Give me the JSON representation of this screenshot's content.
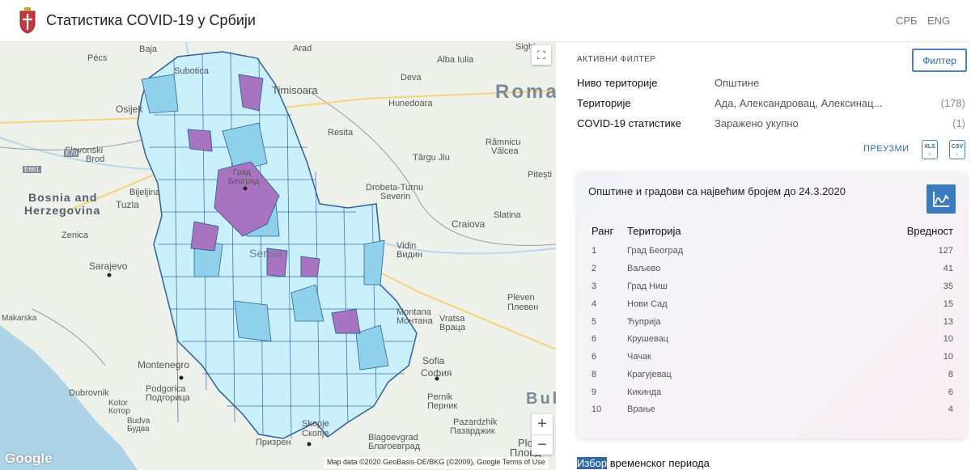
{
  "header": {
    "title": "Статистика COVID-19 у Србији",
    "lang_srb": "СРБ",
    "lang_eng": "ENG"
  },
  "map": {
    "labels": {
      "pecs": "Pécs",
      "baja": "Baja",
      "arad": "Arad",
      "sighisoara": "Sighi",
      "alba_iulia": "Alba Iulia",
      "subotica": "Subotica",
      "timisoara": "Timisoara",
      "deva": "Deva",
      "hunedoara": "Hunedoara",
      "roma": "Roma",
      "osijek": "Osijek",
      "resita": "Resita",
      "ramnicu": "Râmnicu",
      "valcea": "Vâlcea",
      "slavonski": "Slavonski",
      "brod": "Brod",
      "targu_jiu": "Târgu Jiu",
      "pitesti": "Pitești",
      "bosnia": "Bosnia and",
      "herzegovina": "Herzegovina",
      "bijeljina": "Bijeljina",
      "tuzla": "Tuzla",
      "drobeta": "Drobeta-Turnu",
      "severin": "Severin",
      "craiova": "Craiova",
      "slatina": "Slatina",
      "zenica": "Zenica",
      "vidin": "Vidin",
      "vidin_cyr": "Видин",
      "sarajevo": "Sarajevo",
      "serbia": "Serbia",
      "makarska": "Makarska",
      "pleven": "Pleven",
      "pleven_cyr": "Плевен",
      "montana": "Montana",
      "montana_cyr": "Монтана",
      "vratsa": "Vratsa",
      "vratsa_cyr": "Враца",
      "montenegro": "Montenegro",
      "sofia": "Sofia",
      "sofia_cyr": "София",
      "dubrovnik": "Dubrovnik",
      "podgorica": "Podgorica",
      "podgorica_cyr": "Подгорица",
      "bul": "Bul",
      "pernik": "Pernik",
      "pernik_cyr": "Перник",
      "kotor": "Kotor",
      "kotor_cyr": "Котор",
      "budva": "Budva",
      "budva_cyr": "Будва",
      "pazardzhik": "Pazardzhik",
      "pazardzhik_cyr": "Пазарджик",
      "skopje": "Skopje",
      "skopje_cyr": "Скопје",
      "prizren": "Призрен",
      "blagoevgrad": "Blagoevgrad",
      "blagoevgrad_cyr": "Благоевград",
      "plov": "Plov",
      "plov_cyr": "Пловд",
      "grad": "Град",
      "beograd": "Београд"
    },
    "roads": {
      "e70": "E70",
      "e661": "E661"
    },
    "google": "Google",
    "attribution": "Map data ©2020 GeoBasis-DE/BKG (©2009), Google   Terms of Use",
    "fullscreen_icon": "⛶",
    "zoom_in": "+",
    "zoom_out": "−",
    "colors": {
      "light": "#c9f0fb",
      "medium": "#8fd0ea",
      "high": "#a874c0",
      "border": "#2f5f9e"
    }
  },
  "filter": {
    "title": "АКТИВНИ ФИЛТЕР",
    "button": "Филтер",
    "rows": [
      {
        "key": "Ниво територије",
        "value": "Општине",
        "count": ""
      },
      {
        "key": "Територије",
        "value": "Ада, Александровац, Алексинац...",
        "count": "(178)"
      },
      {
        "key": "COVID-19 статистике",
        "value": "Заражено укупно",
        "count": "(1)"
      }
    ],
    "download": "ПРЕУЗМИ",
    "xls": "XLS",
    "csv": "CSV"
  },
  "card": {
    "title": "Општине и градови са највећим бројем до 24.3.2020",
    "col_rank": "Ранг",
    "col_territory": "Територија",
    "col_value": "Вредност",
    "rows": [
      {
        "rank": "1",
        "name": "Град Београд",
        "value": "127"
      },
      {
        "rank": "2",
        "name": "Ваљево",
        "value": "41"
      },
      {
        "rank": "3",
        "name": "Град Ниш",
        "value": "35"
      },
      {
        "rank": "4",
        "name": "Нови Сад",
        "value": "15"
      },
      {
        "rank": "5",
        "name": "Ћуприја",
        "value": "13"
      },
      {
        "rank": "6",
        "name": "Крушевац",
        "value": "10"
      },
      {
        "rank": "6",
        "name": "Чачак",
        "value": "10"
      },
      {
        "rank": "8",
        "name": "Крагујевац",
        "value": "8"
      },
      {
        "rank": "9",
        "name": "Кикинда",
        "value": "6"
      },
      {
        "rank": "10",
        "name": "Врање",
        "value": "4"
      }
    ]
  },
  "period": {
    "highlight": "Избор",
    "rest": " временског периода"
  }
}
